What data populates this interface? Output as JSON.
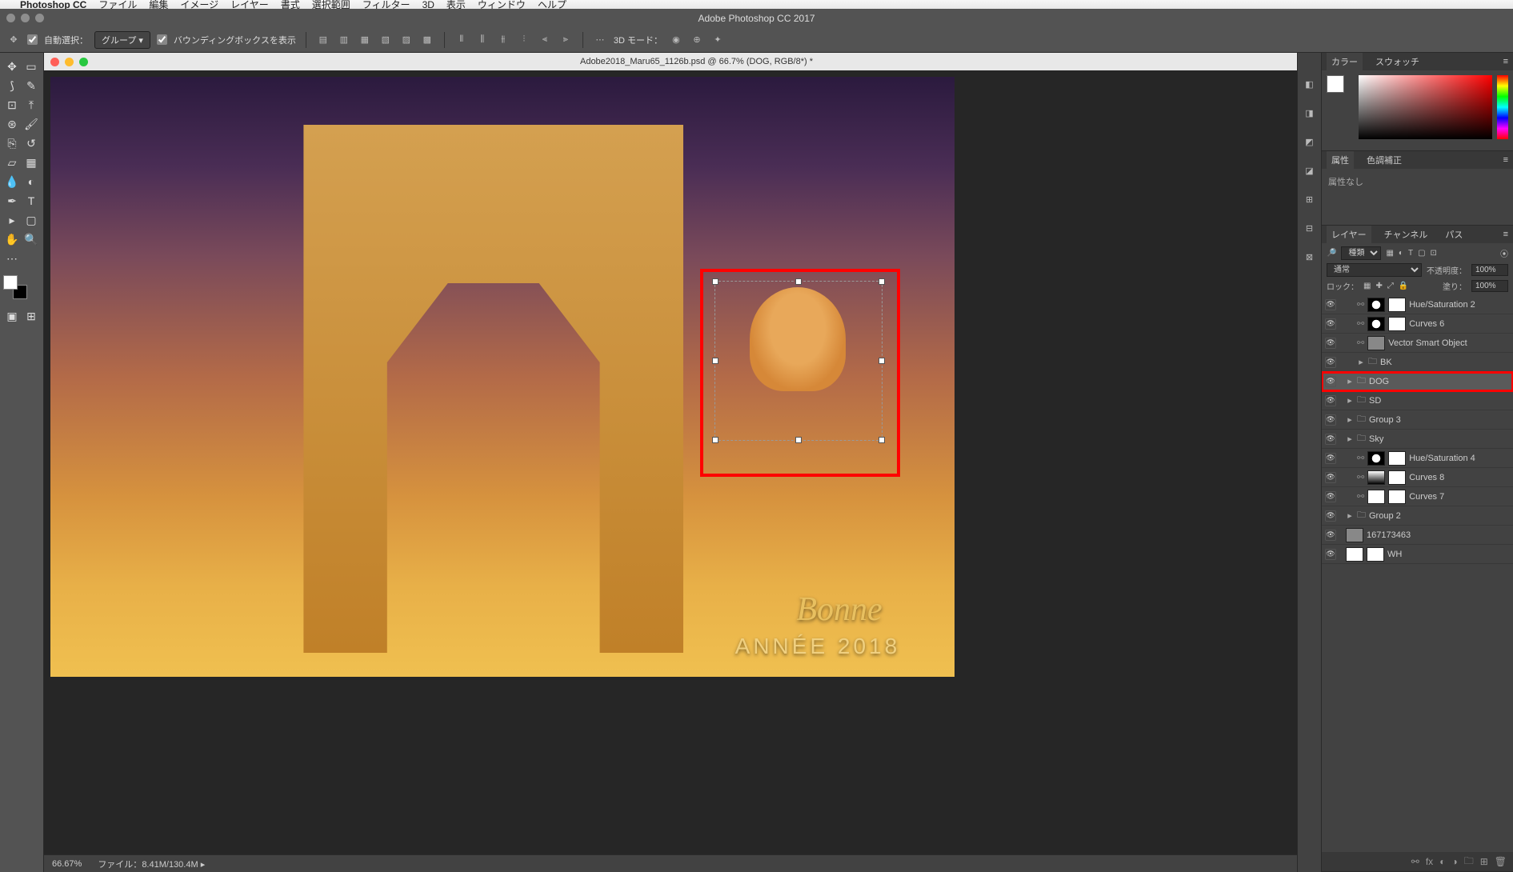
{
  "menu": {
    "items": [
      "Photoshop CC",
      "ファイル",
      "編集",
      "イメージ",
      "レイヤー",
      "書式",
      "選択範囲",
      "フィルター",
      "3D",
      "表示",
      "ウィンドウ",
      "ヘルプ"
    ]
  },
  "titlebar": "Adobe Photoshop CC 2017",
  "options_bar": {
    "auto_select_label": "自動選択：",
    "auto_select_value": "グループ",
    "bounding_box_label": "バウンディングボックスを表示",
    "mode_3d_label": "3D モード："
  },
  "document": {
    "title": "Adobe2018_Maru65_1126b.psd @ 66.7% (DOG, RGB/8*) *",
    "overlay_text1": "Bonne",
    "overlay_text2": "ANNÉE 2018"
  },
  "statusbar": {
    "zoom": "66.67%",
    "filesize_label": "ファイル：",
    "filesize": "8.41M/130.4M"
  },
  "panels": {
    "color": {
      "tab1": "カラー",
      "tab2": "スウォッチ"
    },
    "props": {
      "tab1": "属性",
      "tab2": "色調補正",
      "body": "属性なし"
    },
    "layers": {
      "tab1": "レイヤー",
      "tab2": "チャンネル",
      "tab3": "パス",
      "filter_label": "種類",
      "blend_mode": "通常",
      "opacity_label": "不透明度：",
      "opacity": "100%",
      "lock_label": "ロック：",
      "fill_label": "塗り：",
      "fill": "100%",
      "items": [
        {
          "name": "Hue/Saturation 2",
          "type": "adj",
          "indent": 1
        },
        {
          "name": "Curves 6",
          "type": "adj",
          "indent": 1
        },
        {
          "name": "Vector Smart Object",
          "type": "smart",
          "indent": 1
        },
        {
          "name": "BK",
          "type": "fold",
          "indent": 1,
          "collapsed": true
        },
        {
          "name": "DOG",
          "type": "fold",
          "indent": 0,
          "selected": true,
          "highlighted": true
        },
        {
          "name": "SD",
          "type": "fold",
          "indent": 0,
          "cut": true
        },
        {
          "name": "Group 3",
          "type": "fold",
          "indent": 0
        },
        {
          "name": "Sky",
          "type": "fold",
          "indent": 0
        },
        {
          "name": "Hue/Saturation 4",
          "type": "adj",
          "indent": 1
        },
        {
          "name": "Curves 8",
          "type": "grad",
          "indent": 1
        },
        {
          "name": "Curves 7",
          "type": "white",
          "indent": 1
        },
        {
          "name": "Group 2",
          "type": "fold",
          "indent": 0
        },
        {
          "name": "167173463",
          "type": "img",
          "indent": 0
        },
        {
          "name": "WH",
          "type": "white",
          "indent": 0
        }
      ]
    }
  }
}
